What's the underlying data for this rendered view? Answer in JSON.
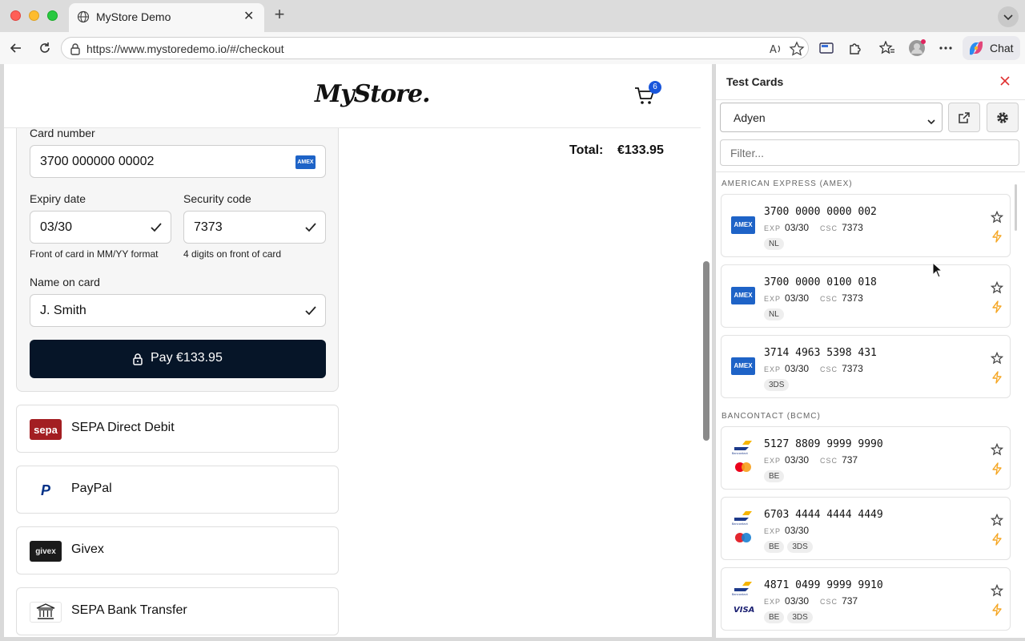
{
  "browser": {
    "tab_title": "MyStore Demo",
    "url": "https://www.mystoredemo.io/#/checkout",
    "chat_label": "Chat",
    "icons": [
      "globe-icon",
      "close-icon",
      "plus-icon",
      "back-arrow-icon",
      "reload-icon",
      "lock-icon",
      "read-aloud-icon",
      "favorite-star-icon",
      "screen-icon",
      "extensions-icon",
      "favorites-icon",
      "profile-icon",
      "more-icon",
      "copilot-icon"
    ]
  },
  "store": {
    "logo": "MyStore.",
    "cart_count": "6",
    "total_label": "Total:",
    "total_value": "€133.95"
  },
  "card_form": {
    "card_number_label": "Card number",
    "card_number_value": "3700 000000 00002",
    "card_brand_badge": "AMEX",
    "expiry_label": "Expiry date",
    "expiry_value": "03/30",
    "expiry_hint": "Front of card in MM/YY format",
    "security_label": "Security code",
    "security_value": "7373",
    "security_hint": "4 digits on front of card",
    "name_label": "Name on card",
    "name_value": "J. Smith",
    "pay_label": "Pay €133.95"
  },
  "payment_methods": [
    {
      "label": "SEPA Direct Debit",
      "logo_text": "sepa",
      "icon": "sepa-icon",
      "logo_color": "#a31e22"
    },
    {
      "label": "PayPal",
      "logo_text": "P",
      "icon": "paypal-icon",
      "logo_color": "#003087"
    },
    {
      "label": "Givex",
      "logo_text": "givex",
      "icon": "givex-icon",
      "logo_color": "#1b1b1b"
    },
    {
      "label": "SEPA Bank Transfer",
      "logo_text": "",
      "icon": "bank-icon",
      "logo_color": "#ffffff"
    }
  ],
  "panel": {
    "title": "Test Cards",
    "provider": "Adyen",
    "filter_placeholder": "Filter...",
    "exp_key": "EXP",
    "csc_key": "CSC",
    "groups": [
      {
        "header": "AMERICAN EXPRESS (AMEX)",
        "cards": [
          {
            "number": "3700 0000 0000 002",
            "exp": "03/30",
            "csc": "7373",
            "tags": [
              "NL"
            ],
            "logo": "amex"
          },
          {
            "number": "3700 0000 0100 018",
            "exp": "03/30",
            "csc": "7373",
            "tags": [
              "NL"
            ],
            "logo": "amex"
          },
          {
            "number": "3714 4963 5398 431",
            "exp": "03/30",
            "csc": "7373",
            "tags": [
              "3DS"
            ],
            "logo": "amex"
          }
        ]
      },
      {
        "header": "BANCONTACT (BCMC)",
        "cards": [
          {
            "number": "5127 8809 9999 9990",
            "exp": "03/30",
            "csc": "737",
            "tags": [
              "BE"
            ],
            "logo": "bcmc-mastercard"
          },
          {
            "number": "6703 4444 4444 4449",
            "exp": "03/30",
            "csc": "",
            "tags": [
              "BE",
              "3DS"
            ],
            "logo": "bcmc-maestro"
          },
          {
            "number": "4871 0499 9999 9910",
            "exp": "03/30",
            "csc": "737",
            "tags": [
              "BE",
              "3DS"
            ],
            "logo": "bcmc-visa"
          }
        ]
      }
    ]
  },
  "colors": {
    "pay_button": "#061528",
    "cart_badge": "#1a56db",
    "amex_blue": "#1e63c7",
    "bolt_orange": "#f5a623",
    "close_red": "#e03131"
  }
}
